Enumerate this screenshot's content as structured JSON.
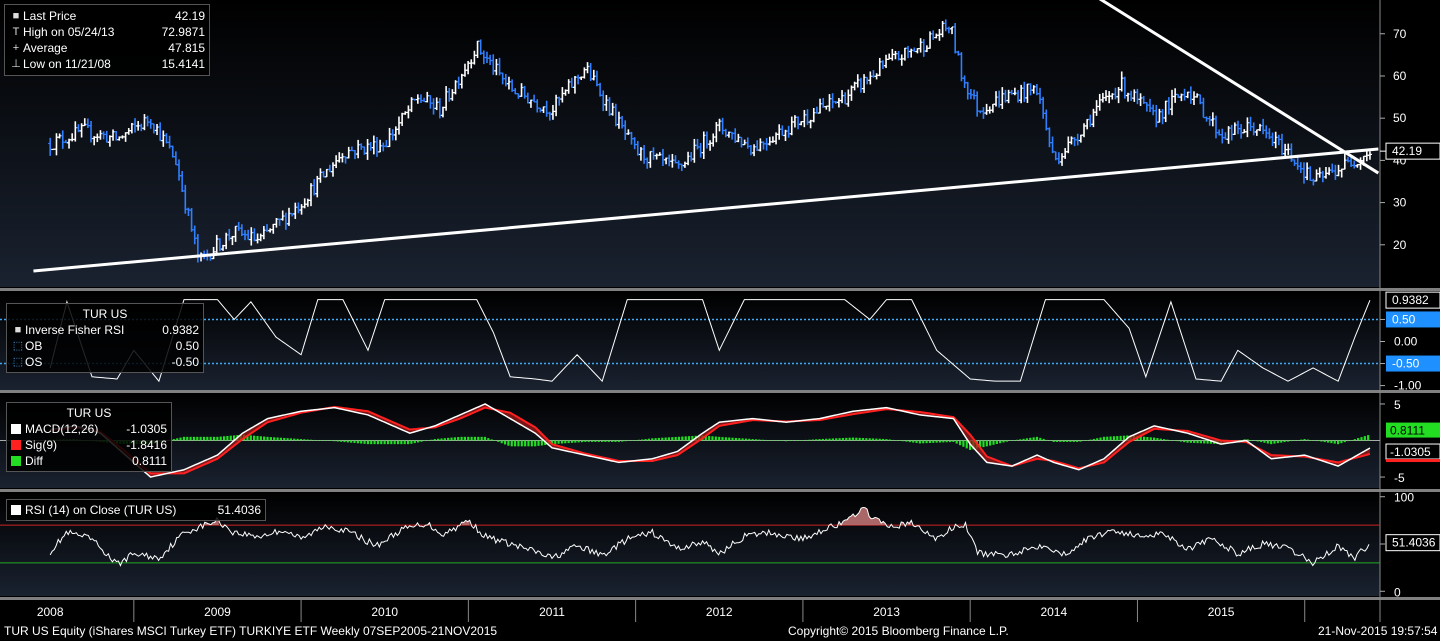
{
  "chart_data": [
    {
      "type": "bar",
      "style": "ohlc-price",
      "ylim": [
        10,
        78
      ],
      "yticks": [
        20,
        30,
        40,
        50,
        60,
        70
      ],
      "last_price_label": "42.19",
      "legend": [
        {
          "symbol": "■",
          "label": "Last Price",
          "value": "42.19"
        },
        {
          "symbol": "T",
          "label": "High on 05/24/13",
          "value": "72.9871"
        },
        {
          "symbol": "+",
          "label": "Average",
          "value": "47.815"
        },
        {
          "symbol": "⊥",
          "label": "Low on 11/21/08",
          "value": "15.4141"
        }
      ],
      "x": [
        2008.0,
        2008.2,
        2008.4,
        2008.6,
        2008.75,
        2008.89,
        2009.0,
        2009.1,
        2009.25,
        2009.5,
        2009.75,
        2010.0,
        2010.2,
        2010.33,
        2010.55,
        2010.75,
        2011.0,
        2011.2,
        2011.5,
        2011.75,
        2012.0,
        2012.2,
        2012.5,
        2012.75,
        2013.0,
        2013.2,
        2013.38,
        2013.45,
        2013.55,
        2013.7,
        2013.9,
        2014.0,
        2014.1,
        2014.25,
        2014.4,
        2014.6,
        2014.8,
        2015.0,
        2015.2,
        2015.4,
        2015.55,
        2015.7,
        2015.89
      ],
      "close": [
        44,
        47,
        45,
        50,
        40,
        16,
        20,
        23,
        21,
        30,
        42,
        44,
        55,
        52,
        67,
        57,
        52,
        62,
        42,
        38,
        48,
        43,
        50,
        55,
        63,
        67,
        72,
        60,
        52,
        55,
        57,
        40,
        44,
        52,
        58,
        50,
        57,
        46,
        48,
        42,
        35,
        38,
        42.19
      ],
      "trendlines": [
        {
          "x": [
            2007.9,
            2015.94
          ],
          "y": [
            13.8,
            42.7
          ]
        },
        {
          "x": [
            2013.6,
            2015.94
          ],
          "y": [
            95,
            37
          ]
        }
      ]
    },
    {
      "type": "line",
      "title": "TUR US",
      "ylim": [
        -1.1,
        1.1
      ],
      "yticks": [
        "0.50",
        "0.00",
        "-0.50",
        "-1.00"
      ],
      "ytick_values": [
        0.5,
        0,
        -0.5,
        -1.0
      ],
      "ob": 0.5,
      "os": -0.5,
      "last_value_label": "0.9382",
      "ob_label": "0.50",
      "os_label": "-0.50",
      "legend": [
        {
          "symbol": "■",
          "label": "Inverse Fisher RSI",
          "value": "0.9382"
        },
        {
          "symbol": "⬚",
          "label": "OB",
          "value": "0.50"
        },
        {
          "symbol": "⬚",
          "label": "OS",
          "value": "-0.50"
        }
      ],
      "x": [
        2008.0,
        2008.1,
        2008.25,
        2008.4,
        2008.5,
        2008.65,
        2008.8,
        2009.0,
        2009.1,
        2009.2,
        2009.35,
        2009.5,
        2009.6,
        2009.75,
        2009.9,
        2010.0,
        2010.15,
        2010.3,
        2010.4,
        2010.55,
        2010.65,
        2010.75,
        2010.9,
        2011.0,
        2011.15,
        2011.3,
        2011.45,
        2011.6,
        2011.75,
        2011.9,
        2012.0,
        2012.15,
        2012.3,
        2012.5,
        2012.65,
        2012.75,
        2012.9,
        2013.0,
        2013.15,
        2013.3,
        2013.5,
        2013.65,
        2013.8,
        2013.95,
        2014.05,
        2014.15,
        2014.3,
        2014.45,
        2014.55,
        2014.7,
        2014.85,
        2015.0,
        2015.1,
        2015.25,
        2015.4,
        2015.55,
        2015.7,
        2015.8,
        2015.89
      ],
      "y": [
        -0.6,
        0.9,
        -0.8,
        -0.85,
        -0.2,
        -0.9,
        0.95,
        0.95,
        0.5,
        0.9,
        0.1,
        -0.3,
        0.95,
        0.95,
        -0.2,
        0.95,
        0.95,
        0.95,
        0.95,
        0.95,
        0.2,
        -0.8,
        -0.85,
        -0.9,
        -0.3,
        -0.9,
        0.95,
        0.95,
        0.95,
        0.95,
        -0.2,
        0.95,
        0.95,
        0.95,
        0.95,
        0.95,
        0.5,
        0.95,
        0.95,
        -0.2,
        -0.85,
        -0.9,
        -0.9,
        0.95,
        0.95,
        0.95,
        0.95,
        0.3,
        -0.8,
        0.9,
        -0.85,
        -0.9,
        -0.2,
        -0.6,
        -0.9,
        -0.6,
        -0.9,
        0.1,
        0.9382
      ]
    },
    {
      "type": "area",
      "title": "TUR US",
      "ylim": [
        -6.5,
        6.5
      ],
      "yticks": [
        "5",
        "-5"
      ],
      "ytick_values": [
        5,
        -5
      ],
      "diff_label": "0.8111",
      "macd_label": "-1.0305",
      "legend": [
        {
          "symbol": "■",
          "label": "MACD(12,26)",
          "value": "-1.0305",
          "color": "#ffffff"
        },
        {
          "symbol": "■",
          "label": "Sig(9)",
          "value": "-1.8416",
          "color": "#ff0000"
        },
        {
          "symbol": "■",
          "label": "Diff",
          "value": "0.8111",
          "color": "#00dd00"
        }
      ],
      "x": [
        2008.0,
        2008.15,
        2008.3,
        2008.45,
        2008.6,
        2008.8,
        2009.0,
        2009.15,
        2009.3,
        2009.5,
        2009.7,
        2009.9,
        2010.0,
        2010.15,
        2010.3,
        2010.45,
        2010.6,
        2010.75,
        2010.9,
        2011.0,
        2011.2,
        2011.4,
        2011.6,
        2011.75,
        2011.9,
        2012.0,
        2012.2,
        2012.4,
        2012.6,
        2012.8,
        2013.0,
        2013.2,
        2013.4,
        2013.5,
        2013.6,
        2013.75,
        2013.9,
        2014.0,
        2014.15,
        2014.3,
        2014.45,
        2014.6,
        2014.8,
        2015.0,
        2015.15,
        2015.3,
        2015.5,
        2015.7,
        2015.89
      ],
      "macd": [
        1.5,
        2.0,
        1.0,
        -2.0,
        -5.0,
        -4.0,
        -2.0,
        1.0,
        3.0,
        4.0,
        4.5,
        3.5,
        2.5,
        1.0,
        2.0,
        3.5,
        5.0,
        3.0,
        1.0,
        -1.0,
        -2.0,
        -3.0,
        -2.5,
        -1.5,
        1.0,
        2.5,
        3.0,
        2.5,
        3.0,
        4.0,
        4.5,
        3.5,
        3.0,
        -0.5,
        -3.0,
        -3.5,
        -2.0,
        -3.0,
        -4.0,
        -2.5,
        0.5,
        2.0,
        1.0,
        -0.5,
        0.0,
        -2.5,
        -2.0,
        -3.5,
        -1.0305
      ],
      "signal": [
        1.4,
        1.8,
        1.2,
        -1.5,
        -4.5,
        -4.5,
        -2.5,
        0.2,
        2.5,
        3.8,
        4.6,
        4.0,
        3.0,
        1.5,
        1.8,
        3.0,
        4.5,
        3.8,
        1.8,
        -0.5,
        -1.8,
        -2.8,
        -2.8,
        -2.0,
        0.3,
        2.0,
        2.8,
        2.6,
        2.8,
        3.6,
        4.3,
        3.9,
        3.2,
        0.8,
        -2.2,
        -3.5,
        -2.5,
        -2.8,
        -3.8,
        -3.0,
        -0.2,
        1.6,
        1.3,
        0.0,
        -0.2,
        -2.0,
        -2.2,
        -3.0,
        -1.8416
      ],
      "diff": [
        0.1,
        0.2,
        -0.2,
        -0.5,
        -0.5,
        0.5,
        0.5,
        0.8,
        0.5,
        0.2,
        -0.1,
        -0.5,
        -0.5,
        -0.5,
        0.2,
        0.5,
        0.5,
        -0.8,
        -0.8,
        -0.5,
        -0.2,
        -0.2,
        0.3,
        0.5,
        0.7,
        0.5,
        0.2,
        -0.1,
        0.2,
        0.4,
        0.2,
        -0.4,
        -0.2,
        -1.3,
        -0.8,
        0.0,
        0.5,
        -0.2,
        -0.2,
        0.5,
        0.7,
        0.4,
        -0.3,
        -0.5,
        0.2,
        -0.5,
        0.2,
        -0.5,
        0.8111
      ]
    },
    {
      "type": "line",
      "title": "RSI (14) on Close (TUR US)",
      "ylim": [
        -5,
        105
      ],
      "yticks": [
        "100",
        "50",
        "0"
      ],
      "ytick_values": [
        100,
        50,
        0
      ],
      "overbought": 70,
      "oversold": 30,
      "last_value_label": "51.4036",
      "legend": [
        {
          "symbol": "■",
          "label": "RSI (14) on Close (TUR US)",
          "value": "51.4036"
        }
      ],
      "x": [
        2008.0,
        2008.1,
        2008.25,
        2008.4,
        2008.5,
        2008.65,
        2008.8,
        2009.0,
        2009.1,
        2009.25,
        2009.4,
        2009.5,
        2009.65,
        2009.8,
        2009.95,
        2010.1,
        2010.25,
        2010.35,
        2010.5,
        2010.6,
        2010.75,
        2010.9,
        2011.0,
        2011.15,
        2011.3,
        2011.45,
        2011.6,
        2011.75,
        2011.9,
        2012.0,
        2012.15,
        2012.3,
        2012.5,
        2012.65,
        2012.75,
        2012.85,
        2013.0,
        2013.15,
        2013.3,
        2013.4,
        2013.47,
        2013.55,
        2013.7,
        2013.85,
        2013.95,
        2014.05,
        2014.2,
        2014.35,
        2014.5,
        2014.65,
        2014.8,
        2014.95,
        2015.1,
        2015.25,
        2015.4,
        2015.55,
        2015.7,
        2015.8,
        2015.89
      ],
      "y": [
        42,
        62,
        55,
        28,
        40,
        35,
        62,
        75,
        62,
        58,
        65,
        55,
        70,
        62,
        48,
        65,
        72,
        60,
        75,
        58,
        50,
        42,
        35,
        48,
        38,
        55,
        62,
        45,
        52,
        40,
        58,
        62,
        55,
        68,
        72,
        88,
        68,
        72,
        55,
        68,
        70,
        40,
        38,
        45,
        50,
        38,
        55,
        65,
        58,
        62,
        45,
        55,
        40,
        50,
        45,
        30,
        48,
        35,
        51.4036
      ]
    }
  ],
  "x_axis_labels": [
    "2008",
    "2009",
    "2010",
    "2011",
    "2012",
    "2013",
    "2014",
    "2015"
  ],
  "footer": {
    "left": "TUR US Equity (iShares MSCI Turkey ETF) TURKIYE ETF  Weekly 07SEP2005-21NOV2015",
    "center": "Copyright© 2015 Bloomberg Finance L.P.",
    "right": "21-Nov-2015 19:57:54"
  },
  "colors": {
    "up_bar": "#ffffff",
    "down_bar": "#2f7fff",
    "trendline": "#ffffff",
    "ob_os_line": "#3fa9f5",
    "macd_line": "#ffffff",
    "signal_line": "#ff2020",
    "diff_bar": "#22dd22",
    "rsi_overbought": "#cc2222",
    "rsi_oversold": "#22aa22",
    "panel_border": "#808080",
    "label_box": "#1e90ff"
  }
}
